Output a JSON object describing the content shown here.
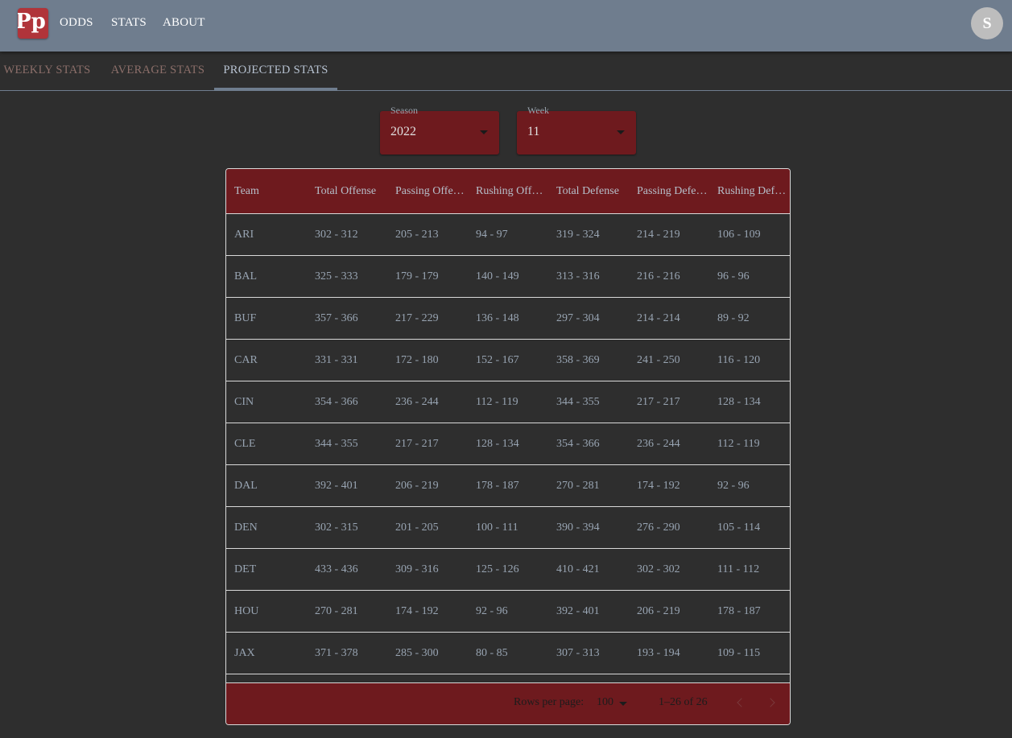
{
  "appbar": {
    "logo_text": "Pp",
    "nav": [
      "ODDS",
      "STATS",
      "ABOUT"
    ],
    "avatar_initial": "S"
  },
  "tabs": [
    "WEEKLY STATS",
    "AVERAGE STATS",
    "PROJECTED STATS"
  ],
  "active_tab": "PROJECTED STATS",
  "filters": {
    "season": {
      "label": "Season",
      "value": "2022"
    },
    "week": {
      "label": "Week",
      "value": "11"
    }
  },
  "table": {
    "columns": [
      "Team",
      "Total Offense",
      "Passing Offe…",
      "Rushing Offe…",
      "Total Defense",
      "Passing Defe…",
      "Rushing Def…"
    ],
    "rows": [
      [
        "ARI",
        "302 - 312",
        "205 - 213",
        "94 - 97",
        "319 - 324",
        "214 - 219",
        "106 - 109"
      ],
      [
        "BAL",
        "325 - 333",
        "179 - 179",
        "140 - 149",
        "313 - 316",
        "216 - 216",
        "96 - 96"
      ],
      [
        "BUF",
        "357 - 366",
        "217 - 229",
        "136 - 148",
        "297 - 304",
        "214 - 214",
        "89 - 92"
      ],
      [
        "CAR",
        "331 - 331",
        "172 - 180",
        "152 - 167",
        "358 - 369",
        "241 - 250",
        "116 - 120"
      ],
      [
        "CIN",
        "354 - 366",
        "236 - 244",
        "112 - 119",
        "344 - 355",
        "217 - 217",
        "128 - 134"
      ],
      [
        "CLE",
        "344 - 355",
        "217 - 217",
        "128 - 134",
        "354 - 366",
        "236 - 244",
        "112 - 119"
      ],
      [
        "DAL",
        "392 - 401",
        "206 - 219",
        "178 - 187",
        "270 - 281",
        "174 - 192",
        "92 - 96"
      ],
      [
        "DEN",
        "302 - 315",
        "201 - 205",
        "100 - 111",
        "390 - 394",
        "276 - 290",
        "105 - 114"
      ],
      [
        "DET",
        "433 - 436",
        "309 - 316",
        "125 - 126",
        "410 - 421",
        "302 - 302",
        "111 - 112"
      ],
      [
        "HOU",
        "270 - 281",
        "174 - 192",
        "92 - 96",
        "392 - 401",
        "206 - 219",
        "178 - 187"
      ],
      [
        "JAX",
        "371 - 378",
        "285 - 300",
        "80 - 85",
        "307 - 313",
        "193 - 194",
        "109 - 115"
      ]
    ]
  },
  "pagination": {
    "rows_per_page_label": "Rows per page:",
    "rows_per_page": "100",
    "range": "1–26 of 26"
  },
  "colors": {
    "appbar": "#6f7d8e",
    "background": "#2e2e2e",
    "accent": "#6e1a1e",
    "logo": "#b0343a"
  }
}
